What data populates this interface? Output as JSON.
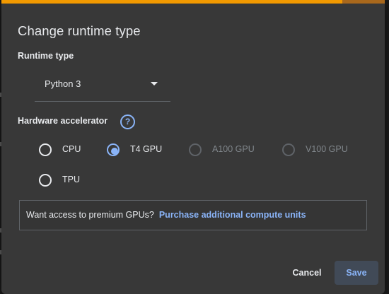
{
  "dialog": {
    "title": "Change runtime type",
    "runtime_type": {
      "label": "Runtime type",
      "selected_value": "Python 3"
    },
    "hardware_accelerator": {
      "label": "Hardware accelerator",
      "help_icon": "help-icon",
      "help_glyph": "?",
      "options": [
        {
          "label": "CPU",
          "selected": false,
          "enabled": true
        },
        {
          "label": "T4 GPU",
          "selected": true,
          "enabled": true
        },
        {
          "label": "A100 GPU",
          "selected": false,
          "enabled": false
        },
        {
          "label": "V100 GPU",
          "selected": false,
          "enabled": false
        },
        {
          "label": "TPU",
          "selected": false,
          "enabled": true
        }
      ]
    },
    "banner": {
      "text": "Want access to premium GPUs?",
      "link_text": "Purchase additional compute units"
    },
    "buttons": {
      "cancel": "Cancel",
      "save": "Save"
    }
  },
  "colors": {
    "accent": "#8ab4f8",
    "stripe": "#f29900",
    "dialog_bg": "#383838",
    "text": "#e8eaed",
    "disabled_text": "#80868b"
  }
}
